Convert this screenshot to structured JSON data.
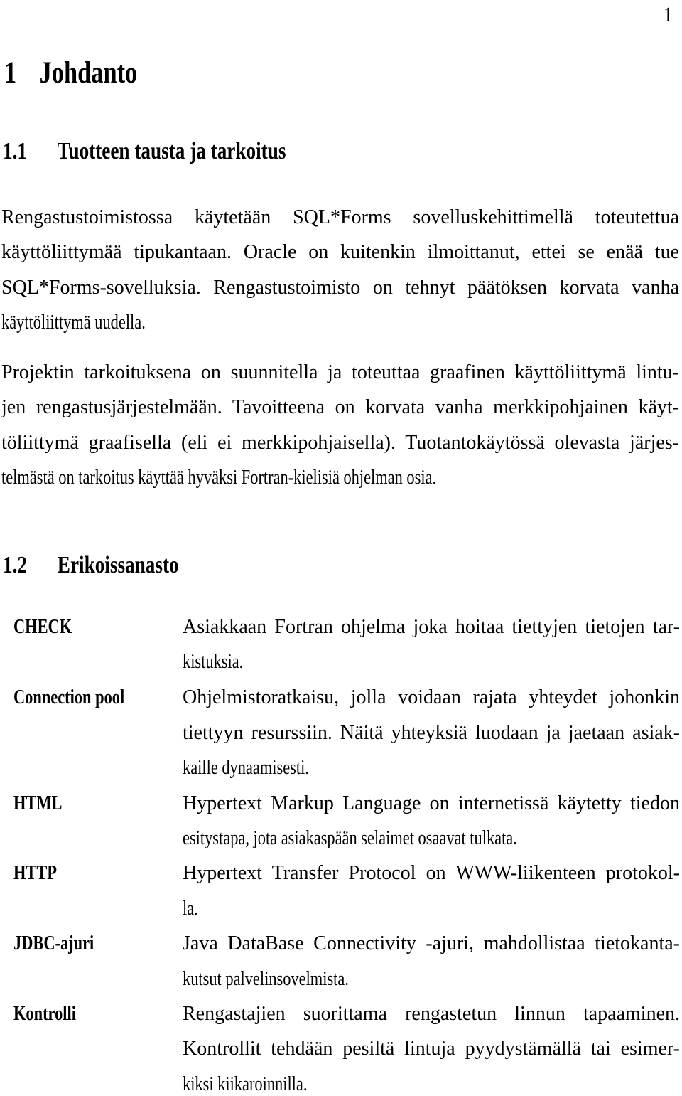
{
  "page_number": "1",
  "chapter": {
    "number": "1",
    "title": "Johdanto"
  },
  "section_1_1": {
    "number": "1.1",
    "title": "Tuotteen tausta ja tarkoitus",
    "paragraph_1_lines": [
      "Rengastustoimistossa käytetään SQL*Forms sovelluskehittimellä toteutettua",
      "käyttöliittymää tipukantaan. Oracle on kuitenkin ilmoittanut, ettei se enää tue",
      "SQL*Forms-sovelluksia. Rengastustoimisto on tehnyt päätöksen korvata vanha",
      "käyttöliittymä uudella."
    ],
    "paragraph_2_lines": [
      "Projektin tarkoituksena on suunnitella ja toteuttaa graafinen käyttöliittymä lintu-",
      "jen rengastusjärjestelmään. Tavoitteena on korvata vanha merkkipohjainen käyt-",
      "töliittymä graafisella (eli ei merkkipohjaisella). Tuotantokäytössä olevasta järjes-",
      "telmästä on tarkoitus käyttää hyväksi Fortran-kielisiä ohjelman osia."
    ]
  },
  "section_1_2": {
    "number": "1.2",
    "title": "Erikoissanasto",
    "glossary": [
      {
        "term": "CHECK",
        "definition_lines": [
          "Asiakkaan Fortran ohjelma joka hoitaa tiettyjen tietojen tar-",
          "kistuksia."
        ]
      },
      {
        "term": "Connection pool",
        "definition_lines": [
          "Ohjelmistoratkaisu, jolla voidaan rajata yhteydet johonkin",
          "tiettyyn resurssiin. Näitä yhteyksiä luodaan ja jaetaan asiak-",
          "kaille dynaamisesti."
        ]
      },
      {
        "term": "HTML",
        "definition_lines": [
          "Hypertext Markup Language on internetissä käytetty tiedon",
          "esitystapa, jota asiakaspään selaimet osaavat tulkata."
        ]
      },
      {
        "term": "HTTP",
        "definition_lines": [
          "Hypertext Transfer Protocol on WWW-liikenteen protokol-",
          "la."
        ]
      },
      {
        "term": "JDBC-ajuri",
        "definition_lines": [
          "Java DataBase Connectivity -ajuri, mahdollistaa tietokanta-",
          "kutsut palvelinsovelmista."
        ]
      },
      {
        "term": "Kontrolli",
        "definition_lines": [
          "Rengastajien suorittama rengastetun linnun tapaaminen.",
          "Kontrollit tehdään pesiltä lintuja pyydystämällä tai esimer-",
          "kiksi kiikaroinnilla."
        ]
      }
    ]
  }
}
